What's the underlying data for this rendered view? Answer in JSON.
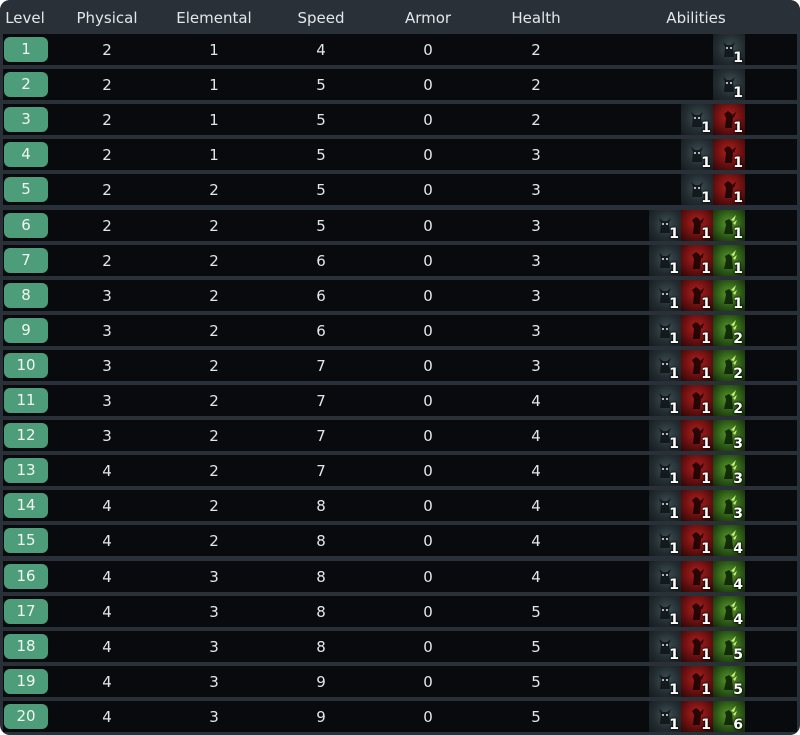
{
  "headers": {
    "level": "Level",
    "physical": "Physical",
    "elemental": "Elemental",
    "speed": "Speed",
    "armor": "Armor",
    "health": "Health",
    "abilities": "Abilities"
  },
  "ability_icons": {
    "wolf": "wolf-icon",
    "blood": "blood-claw-icon",
    "poison": "poison-icon"
  },
  "colors": {
    "level_badge": "#4e9d7a",
    "row_background": "#080a0d",
    "frame": "#2a3038",
    "text": "#e4e7ea"
  },
  "rows": [
    {
      "level": "1",
      "physical": "2",
      "elemental": "1",
      "speed": "4",
      "armor": "0",
      "health": "2",
      "abilities": [
        {
          "icon": "wolf",
          "count": "1"
        }
      ]
    },
    {
      "level": "2",
      "physical": "2",
      "elemental": "1",
      "speed": "5",
      "armor": "0",
      "health": "2",
      "abilities": [
        {
          "icon": "wolf",
          "count": "1"
        }
      ]
    },
    {
      "level": "3",
      "physical": "2",
      "elemental": "1",
      "speed": "5",
      "armor": "0",
      "health": "2",
      "abilities": [
        {
          "icon": "wolf",
          "count": "1"
        },
        {
          "icon": "blood",
          "count": "1"
        }
      ]
    },
    {
      "level": "4",
      "physical": "2",
      "elemental": "1",
      "speed": "5",
      "armor": "0",
      "health": "3",
      "abilities": [
        {
          "icon": "wolf",
          "count": "1"
        },
        {
          "icon": "blood",
          "count": "1"
        }
      ]
    },
    {
      "level": "5",
      "physical": "2",
      "elemental": "2",
      "speed": "5",
      "armor": "0",
      "health": "3",
      "abilities": [
        {
          "icon": "wolf",
          "count": "1"
        },
        {
          "icon": "blood",
          "count": "1"
        }
      ]
    },
    {
      "level": "6",
      "physical": "2",
      "elemental": "2",
      "speed": "5",
      "armor": "0",
      "health": "3",
      "abilities": [
        {
          "icon": "wolf",
          "count": "1"
        },
        {
          "icon": "blood",
          "count": "1"
        },
        {
          "icon": "poison",
          "count": "1"
        }
      ]
    },
    {
      "level": "7",
      "physical": "2",
      "elemental": "2",
      "speed": "6",
      "armor": "0",
      "health": "3",
      "abilities": [
        {
          "icon": "wolf",
          "count": "1"
        },
        {
          "icon": "blood",
          "count": "1"
        },
        {
          "icon": "poison",
          "count": "1"
        }
      ]
    },
    {
      "level": "8",
      "physical": "3",
      "elemental": "2",
      "speed": "6",
      "armor": "0",
      "health": "3",
      "abilities": [
        {
          "icon": "wolf",
          "count": "1"
        },
        {
          "icon": "blood",
          "count": "1"
        },
        {
          "icon": "poison",
          "count": "1"
        }
      ]
    },
    {
      "level": "9",
      "physical": "3",
      "elemental": "2",
      "speed": "6",
      "armor": "0",
      "health": "3",
      "abilities": [
        {
          "icon": "wolf",
          "count": "1"
        },
        {
          "icon": "blood",
          "count": "1"
        },
        {
          "icon": "poison",
          "count": "2"
        }
      ]
    },
    {
      "level": "10",
      "physical": "3",
      "elemental": "2",
      "speed": "7",
      "armor": "0",
      "health": "3",
      "abilities": [
        {
          "icon": "wolf",
          "count": "1"
        },
        {
          "icon": "blood",
          "count": "1"
        },
        {
          "icon": "poison",
          "count": "2"
        }
      ]
    },
    {
      "level": "11",
      "physical": "3",
      "elemental": "2",
      "speed": "7",
      "armor": "0",
      "health": "4",
      "abilities": [
        {
          "icon": "wolf",
          "count": "1"
        },
        {
          "icon": "blood",
          "count": "1"
        },
        {
          "icon": "poison",
          "count": "2"
        }
      ]
    },
    {
      "level": "12",
      "physical": "3",
      "elemental": "2",
      "speed": "7",
      "armor": "0",
      "health": "4",
      "abilities": [
        {
          "icon": "wolf",
          "count": "1"
        },
        {
          "icon": "blood",
          "count": "1"
        },
        {
          "icon": "poison",
          "count": "3"
        }
      ]
    },
    {
      "level": "13",
      "physical": "4",
      "elemental": "2",
      "speed": "7",
      "armor": "0",
      "health": "4",
      "abilities": [
        {
          "icon": "wolf",
          "count": "1"
        },
        {
          "icon": "blood",
          "count": "1"
        },
        {
          "icon": "poison",
          "count": "3"
        }
      ]
    },
    {
      "level": "14",
      "physical": "4",
      "elemental": "2",
      "speed": "8",
      "armor": "0",
      "health": "4",
      "abilities": [
        {
          "icon": "wolf",
          "count": "1"
        },
        {
          "icon": "blood",
          "count": "1"
        },
        {
          "icon": "poison",
          "count": "3"
        }
      ]
    },
    {
      "level": "15",
      "physical": "4",
      "elemental": "2",
      "speed": "8",
      "armor": "0",
      "health": "4",
      "abilities": [
        {
          "icon": "wolf",
          "count": "1"
        },
        {
          "icon": "blood",
          "count": "1"
        },
        {
          "icon": "poison",
          "count": "4"
        }
      ]
    },
    {
      "level": "16",
      "physical": "4",
      "elemental": "3",
      "speed": "8",
      "armor": "0",
      "health": "4",
      "abilities": [
        {
          "icon": "wolf",
          "count": "1"
        },
        {
          "icon": "blood",
          "count": "1"
        },
        {
          "icon": "poison",
          "count": "4"
        }
      ]
    },
    {
      "level": "17",
      "physical": "4",
      "elemental": "3",
      "speed": "8",
      "armor": "0",
      "health": "5",
      "abilities": [
        {
          "icon": "wolf",
          "count": "1"
        },
        {
          "icon": "blood",
          "count": "1"
        },
        {
          "icon": "poison",
          "count": "4"
        }
      ]
    },
    {
      "level": "18",
      "physical": "4",
      "elemental": "3",
      "speed": "8",
      "armor": "0",
      "health": "5",
      "abilities": [
        {
          "icon": "wolf",
          "count": "1"
        },
        {
          "icon": "blood",
          "count": "1"
        },
        {
          "icon": "poison",
          "count": "5"
        }
      ]
    },
    {
      "level": "19",
      "physical": "4",
      "elemental": "3",
      "speed": "9",
      "armor": "0",
      "health": "5",
      "abilities": [
        {
          "icon": "wolf",
          "count": "1"
        },
        {
          "icon": "blood",
          "count": "1"
        },
        {
          "icon": "poison",
          "count": "5"
        }
      ]
    },
    {
      "level": "20",
      "physical": "4",
      "elemental": "3",
      "speed": "9",
      "armor": "0",
      "health": "5",
      "abilities": [
        {
          "icon": "wolf",
          "count": "1"
        },
        {
          "icon": "blood",
          "count": "1"
        },
        {
          "icon": "poison",
          "count": "6"
        }
      ]
    }
  ]
}
